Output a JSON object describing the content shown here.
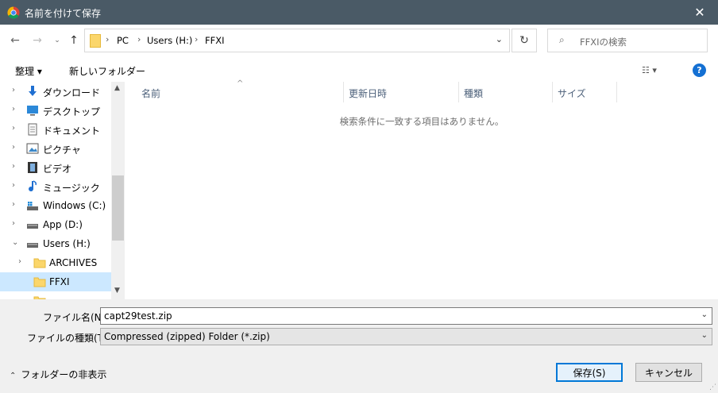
{
  "window": {
    "title": "名前を付けて保存",
    "close_icon": "close-icon",
    "app_icon": "chrome-icon"
  },
  "nav": {
    "back_icon": "back-arrow-icon",
    "forward_icon": "forward-arrow-icon",
    "recent_icon": "chevron-down-icon",
    "up_icon": "up-arrow-icon",
    "breadcrumbs": [
      "PC",
      "Users (H:)",
      "FFXI"
    ],
    "refresh_icon": "refresh-icon",
    "search_placeholder": "FFXIの検索"
  },
  "toolbar": {
    "organize": "整理 ▾",
    "new_folder": "新しいフォルダー",
    "view_icon": "view-options-icon",
    "help_label": "?"
  },
  "sidebar": {
    "items": [
      {
        "label": "ダウンロード",
        "icon": "download-icon",
        "color": "#1f6fd1"
      },
      {
        "label": "デスクトップ",
        "icon": "desktop-icon",
        "color": "#2b88d8"
      },
      {
        "label": "ドキュメント",
        "icon": "document-icon",
        "color": "#666666"
      },
      {
        "label": "ピクチャ",
        "icon": "pictures-icon",
        "color": "#555555"
      },
      {
        "label": "ビデオ",
        "icon": "video-icon",
        "color": "#333333"
      },
      {
        "label": "ミュージック",
        "icon": "music-icon",
        "color": "#1f6fd1"
      },
      {
        "label": "Windows (C:)",
        "icon": "drive-windows-icon",
        "color": "#555555"
      },
      {
        "label": "App (D:)",
        "icon": "drive-icon",
        "color": "#555555"
      },
      {
        "label": "Users (H:)",
        "icon": "drive-icon",
        "color": "#555555"
      },
      {
        "label": "ARCHIVES",
        "icon": "folder-icon",
        "color": "#fbd66b"
      },
      {
        "label": "FFXI",
        "icon": "folder-icon",
        "color": "#fbd66b"
      }
    ]
  },
  "filepane": {
    "columns": [
      "名前",
      "更新日時",
      "種類",
      "サイズ"
    ],
    "empty_message": "検索条件に一致する項目はありません。"
  },
  "form": {
    "filename_label": "ファイル名(N):",
    "filename_value": "capt29test.zip",
    "filetype_label": "ファイルの種類(T):",
    "filetype_value": "Compressed (zipped) Folder (*.zip)",
    "hide_folders": "フォルダーの非表示",
    "save_button": "保存(S)",
    "cancel_button": "キャンセル"
  }
}
